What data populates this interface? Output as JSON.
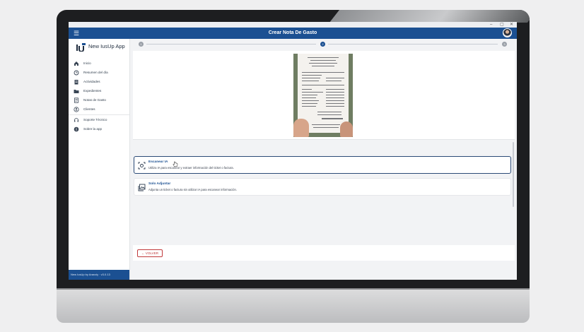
{
  "window": {
    "controls": [
      "–",
      "▢",
      "✕"
    ]
  },
  "header": {
    "title": "Crear Nota De Gasto"
  },
  "sidebar": {
    "app_name": "New IusUp App",
    "items": [
      {
        "label": "Inicio",
        "icon": "home-icon"
      },
      {
        "label": "Resumen del día",
        "icon": "clock-icon"
      },
      {
        "label": "Actividades",
        "icon": "clipboard-icon"
      },
      {
        "label": "Expedientes",
        "icon": "folder-icon"
      },
      {
        "label": "Notas de Gasto",
        "icon": "receipt-icon"
      },
      {
        "label": "Clientes",
        "icon": "person-icon"
      },
      {
        "label": "Soporte Técnico",
        "icon": "headset-icon"
      },
      {
        "label": "Sobre la app",
        "icon": "info-icon"
      }
    ],
    "footer": "New IusUp by Aranzly · v3.0.13"
  },
  "stepper": {
    "steps": [
      "1",
      "2",
      "3"
    ],
    "current": 2
  },
  "options": [
    {
      "title": "Escanear IA",
      "description": "Utiliza IA para escanear y extraer información del ticket o factura.",
      "icon": "scan-ai-icon",
      "selected": true
    },
    {
      "title": "Solo Adjuntar",
      "description": "Adjunta un ticket o factura sin utilizar IA para escanear información.",
      "icon": "attach-image-icon",
      "selected": false
    }
  ],
  "actions": {
    "back_label": "VOLVER"
  },
  "colors": {
    "primary": "#1b5092",
    "accent": "#c0393b",
    "background": "#f2f3f5"
  }
}
